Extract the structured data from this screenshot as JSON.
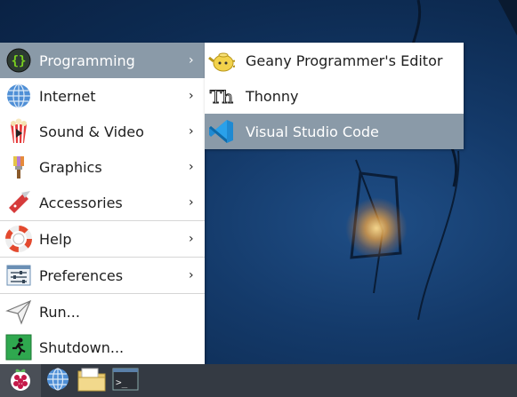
{
  "colors": {
    "menu_highlight": "#8a9aa8",
    "taskbar": "#343a43",
    "desktop": "#143a6a",
    "vscode_blue": "#1f8ad2"
  },
  "main_menu": {
    "items": [
      {
        "label": "Programming",
        "icon": "braces-icon",
        "submenu": true,
        "active": true
      },
      {
        "label": "Internet",
        "icon": "globe-icon",
        "submenu": true
      },
      {
        "label": "Sound & Video",
        "icon": "popcorn-icon",
        "submenu": true
      },
      {
        "label": "Graphics",
        "icon": "paintbrush-icon",
        "submenu": true
      },
      {
        "label": "Accessories",
        "icon": "swiss-knife-icon",
        "submenu": true
      },
      {
        "label": "Help",
        "icon": "lifebuoy-icon",
        "submenu": true
      },
      {
        "label": "Preferences",
        "icon": "sliders-icon",
        "submenu": true
      },
      {
        "label": "Run...",
        "icon": "paper-plane-icon",
        "submenu": false
      },
      {
        "label": "Shutdown...",
        "icon": "exit-icon",
        "submenu": false
      }
    ]
  },
  "submenu": {
    "items": [
      {
        "label": "Geany Programmer's Editor",
        "icon": "geany-teapot-icon"
      },
      {
        "label": "Thonny",
        "icon": "thonny-icon",
        "icon_text": "Th"
      },
      {
        "label": "Visual Studio Code",
        "icon": "vscode-icon",
        "active": true
      }
    ]
  },
  "taskbar": {
    "buttons": [
      {
        "name": "raspberry-menu",
        "icon": "raspberry-icon"
      },
      {
        "name": "web-browser",
        "icon": "globe-icon"
      },
      {
        "name": "file-manager",
        "icon": "folder-icon"
      },
      {
        "name": "terminal",
        "icon": "terminal-icon",
        "icon_text": ">_"
      }
    ]
  }
}
